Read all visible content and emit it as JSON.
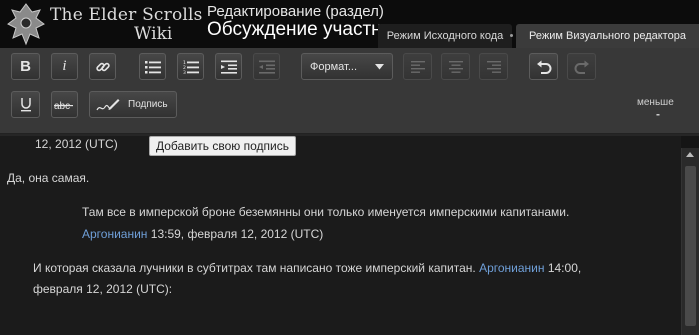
{
  "header": {
    "logo_line1": "The Elder Scrolls",
    "logo_line2": "Wiki",
    "edit_subtitle": "Редактирование (раздел)",
    "page_title": "Обсуждение участника"
  },
  "mode_tabs": {
    "source_label": "Режим Исходного кода",
    "visual_label": "Режим Визуального редактора"
  },
  "toolbar": {
    "format_label": "Формат...",
    "signature_label": "Подпись",
    "less_label": "меньше",
    "less_mark": "-",
    "tooltip": "Добавить свою подпись"
  },
  "content": {
    "cut_line": "12, 2012 (UTC)",
    "line1": "Да, она самая.",
    "reply1_text": "Там все в имперской броне беземянны они только именуется имперскими капитанами.",
    "reply1_user": "Аргонианин",
    "reply1_stamp": " 13:59, февраля 12, 2012 (UTC)",
    "reply2_text": "И которая сказала лучники в субтитрах там написано тоже имперский капитан.",
    "reply2_user": "Аргонианин",
    "reply2_stamp_a": " 14:00,",
    "reply2_stamp_b": "февраля 12, 2012 (UTC):"
  },
  "icons": {
    "bold": "bold-icon",
    "italic": "italic-icon",
    "link": "link-icon",
    "bullets": "bulleted-list-icon",
    "numbers": "numbered-list-icon",
    "indent": "indent-icon",
    "outdent": "outdent-icon",
    "align_left": "align-left-icon",
    "align_center": "align-center-icon",
    "align_right": "align-right-icon",
    "undo": "undo-icon",
    "redo": "redo-icon",
    "underline": "underline-icon",
    "strike": "strikethrough-icon",
    "signature": "signature-pen-icon"
  },
  "colors": {
    "link": "#6f9fd8",
    "toolbar_bg": "#383838",
    "content_bg": "#1b1b1b"
  }
}
